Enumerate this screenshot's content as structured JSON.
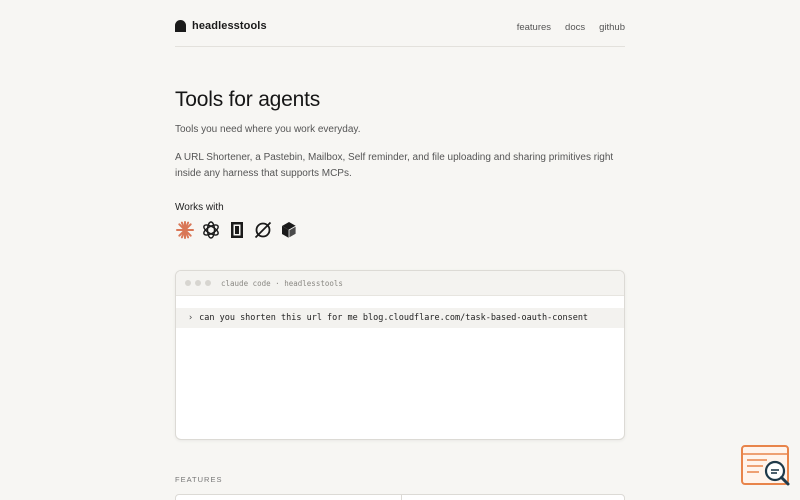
{
  "header": {
    "brand": "headlesstools",
    "nav": [
      {
        "label": "features"
      },
      {
        "label": "docs"
      },
      {
        "label": "github"
      }
    ]
  },
  "hero": {
    "title": "Tools for agents",
    "subtitle": "Tools you need where you work everyday.",
    "description": "A URL Shortener, a Pastebin, Mailbox, Self reminder, and file uploading and sharing primitives right inside any harness that supports MCPs.",
    "works_with_label": "Works with",
    "integrations": [
      {
        "icon": "claude-icon",
        "color": "#d97757"
      },
      {
        "icon": "openai-icon",
        "color": "#1a1a1a"
      },
      {
        "icon": "cursor-icon",
        "color": "#1a1a1a"
      },
      {
        "icon": "opencode-icon",
        "color": "#1a1a1a"
      },
      {
        "icon": "cube-icon",
        "color": "#1a1a1a"
      }
    ]
  },
  "terminal": {
    "title": "claude code · headlesstools",
    "prompt_symbol": "›",
    "command": "can you shorten this url for me blog.cloudflare.com/task-based-oauth-consent"
  },
  "features": {
    "label": "FEATURES"
  },
  "colors": {
    "background": "#f7f6f3",
    "accent": "#d97757",
    "badge": "#e8844a"
  }
}
